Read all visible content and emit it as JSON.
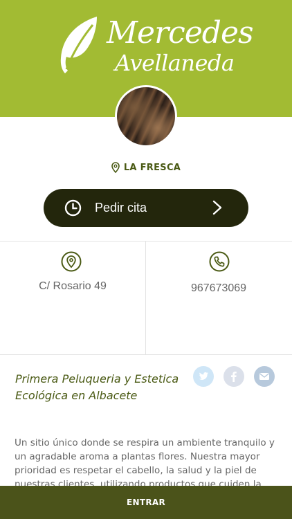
{
  "brand": {
    "line1": "Mercedes",
    "line2": "Avellaneda",
    "logo_icon": "leaf-icon",
    "header_color": "#a2bb33"
  },
  "location": {
    "label": "LA FRESCA",
    "icon": "map-pin-icon"
  },
  "cta": {
    "label": "Pedir cita",
    "icon": "clock-icon",
    "trailing_icon": "chevron-right-icon",
    "color": "#23260c"
  },
  "info": {
    "address": {
      "icon": "map-pin-icon",
      "text": "C/ Rosario 49"
    },
    "phone": {
      "icon": "phone-icon",
      "text": "967673069"
    }
  },
  "description": {
    "title": "Primera Peluqueria y Estetica Ecológica en Albacete",
    "body": "Un sitio único donde se respira un ambiente tranquilo y un agradable aroma a plantas flores. Nuestra mayor prioridad es respetar el cabello, la salud y la piel de nuestras clientes, utilizando productos que cuiden la"
  },
  "social": [
    {
      "icon": "twitter-icon"
    },
    {
      "icon": "facebook-icon"
    },
    {
      "icon": "email-icon"
    }
  ],
  "footer": {
    "label": "ENTRAR",
    "color": "#4b531a"
  }
}
